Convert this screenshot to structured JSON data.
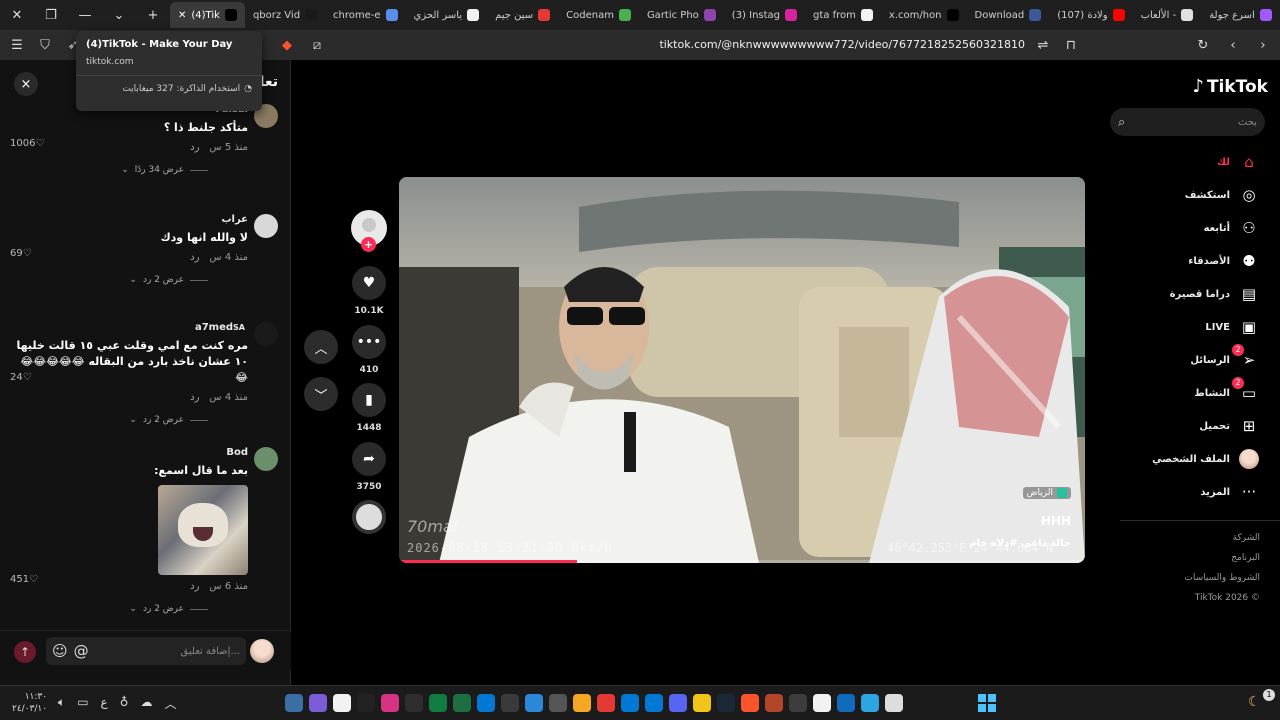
{
  "browser": {
    "tabs": [
      {
        "label": "(4)Tik",
        "active": true,
        "favicon_color": "#000000"
      },
      {
        "label": "qborz Vid",
        "favicon_color": "#1a1a1a"
      },
      {
        "label": "chrome-e",
        "favicon_color": "#5b8def"
      },
      {
        "label": "ياسر الحزي",
        "favicon_color": "#f2f2f2"
      },
      {
        "label": "سين جيم",
        "favicon_color": "#e53935"
      },
      {
        "label": "Codenam",
        "favicon_color": "#4caf50"
      },
      {
        "label": "Gartic Pho",
        "favicon_color": "#8e44ad"
      },
      {
        "label": "(3) Instag",
        "favicon_color": "#d6249f"
      },
      {
        "label": "gta from",
        "favicon_color": "#f2f2f2"
      },
      {
        "label": "x.com/hon",
        "favicon_color": "#000000"
      },
      {
        "label": "Download",
        "favicon_color": "#3b5998"
      },
      {
        "label": "(107) ولادة",
        "favicon_color": "#ff0000"
      },
      {
        "label": "الألعاب -",
        "favicon_color": "#e0e0e0"
      },
      {
        "label": "اسرع جولة",
        "favicon_color": "#a259ff"
      }
    ],
    "url": "tiktok.com/@nknwwwwwwwww772/video/7677218252560321810",
    "tooltip": {
      "title": "(4)TikTok - Make Your Day",
      "host": "tiktok.com",
      "memory": "استخدام الذاكرة: 327 ميغابايت"
    }
  },
  "comments_panel": {
    "header": "تعل",
    "close_icon": "×",
    "comments": [
      {
        "author": "Faisal",
        "text": "متأكد جلنط ذا ؟",
        "time": "منذ 5 س",
        "reply": "رد",
        "likes": "1006",
        "view_replies": "عرض 34 ردًا",
        "avatar_color": "#8a7a62"
      },
      {
        "author": "عراب",
        "text": "لا والله انها ودك",
        "time": "منذ 4 س",
        "reply": "رد",
        "likes": "69",
        "view_replies": "عرض 2 رد",
        "avatar_color": "#d8d8d8"
      },
      {
        "author": "a7med",
        "author_tag": "SA",
        "text": "مره كنت مع امي وقلت عبي ١٥ قالت خليها ١٠ عشان ناخذ بارد من البقاله 😂😂😂😂😂😂",
        "time": "منذ 4 س",
        "reply": "رد",
        "likes": "24",
        "view_replies": "عرض 2 رد",
        "avatar_color": "#1a1a1a"
      },
      {
        "author": "Bod",
        "text": "بعد ما قال اسمع:",
        "time": "منذ 6 س",
        "reply": "رد",
        "likes": "451",
        "view_replies": "عرض 2 رد",
        "avatar_color": "#6b8e6b",
        "has_sticker": true
      }
    ],
    "input_placeholder": "إضافة تعليق...",
    "at_icon": "@",
    "emoji_icon": "☺"
  },
  "video": {
    "author": "HHH",
    "caption": "حالة داعي #دلاه خام",
    "location": "الرياض",
    "watermark": "70mai",
    "timestamp": "2026-08-18  13:31:30   0km/h",
    "coords": "46°42.253'E  24°44.684'N",
    "progress": 0.26
  },
  "actions": {
    "likes": "10.1K",
    "comments": "410",
    "saves": "1448",
    "shares": "3750"
  },
  "sidebar": {
    "logo": "TikTok",
    "search_placeholder": "بحث",
    "nav": [
      {
        "label": "لك",
        "icon": "home-icon",
        "glyph": "⌂",
        "active": true
      },
      {
        "label": "استكشف",
        "icon": "compass-icon",
        "glyph": "◎"
      },
      {
        "label": "أتابعه",
        "icon": "user-plus-icon",
        "glyph": "⚇"
      },
      {
        "label": "الأصدقاء",
        "icon": "friends-icon",
        "glyph": "⚉"
      },
      {
        "label": "دراما قصيرة",
        "icon": "film-icon",
        "glyph": "▤"
      },
      {
        "label": "LIVE",
        "icon": "live-tv-icon",
        "glyph": "▣"
      },
      {
        "label": "الرسائل",
        "icon": "send-icon",
        "glyph": "➢",
        "badge": "2"
      },
      {
        "label": "النشاط",
        "icon": "activity-icon",
        "glyph": "▭",
        "badge": "2"
      },
      {
        "label": "تحميل",
        "icon": "upload-icon",
        "glyph": "⊞"
      },
      {
        "label": "الملف الشخصي",
        "icon": "profile-avatar-icon",
        "glyph": ""
      },
      {
        "label": "المزيد",
        "icon": "more-icon",
        "glyph": "···"
      }
    ],
    "footer": [
      "الشركة",
      "البرنامج",
      "الشروط والسياسات",
      "© 2026 TikTok"
    ]
  },
  "taskbar": {
    "time": "١١:٣٠",
    "date": "٢٤/٠٣/١٠",
    "lang": "ع"
  }
}
